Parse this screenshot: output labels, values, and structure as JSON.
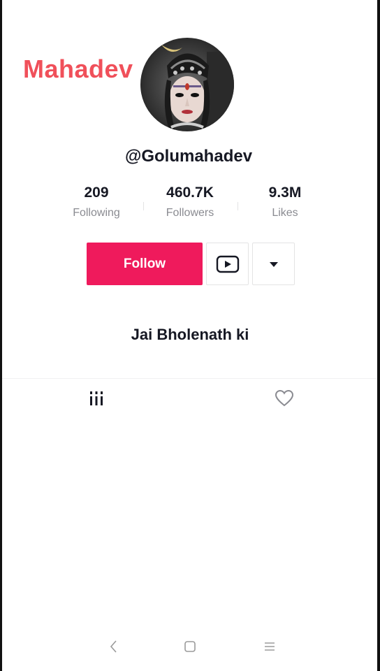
{
  "watermark": {
    "text": "Mahadev"
  },
  "profile": {
    "avatar_icon": "profile-photo",
    "username": "@Golumahadev",
    "bio": "Jai Bholenath ki"
  },
  "stats": {
    "following": {
      "value": "209",
      "label": "Following"
    },
    "followers": {
      "value": "460.7K",
      "label": "Followers"
    },
    "likes": {
      "value": "9.3M",
      "label": "Likes"
    }
  },
  "actions": {
    "follow_label": "Follow",
    "youtube_icon": "youtube-icon",
    "more_icon": "caret-down-icon"
  },
  "tabs": {
    "videos_icon": "videos-grid-icon",
    "liked_icon": "heart-outline-icon"
  },
  "nav": {
    "back_icon": "back-chevron-icon",
    "home_icon": "home-square-icon",
    "recent_icon": "menu-lines-icon"
  },
  "colors": {
    "accent": "#ef1a5c",
    "watermark": "#f0505a",
    "text_primary": "#161823",
    "text_secondary": "#8a8b91"
  }
}
